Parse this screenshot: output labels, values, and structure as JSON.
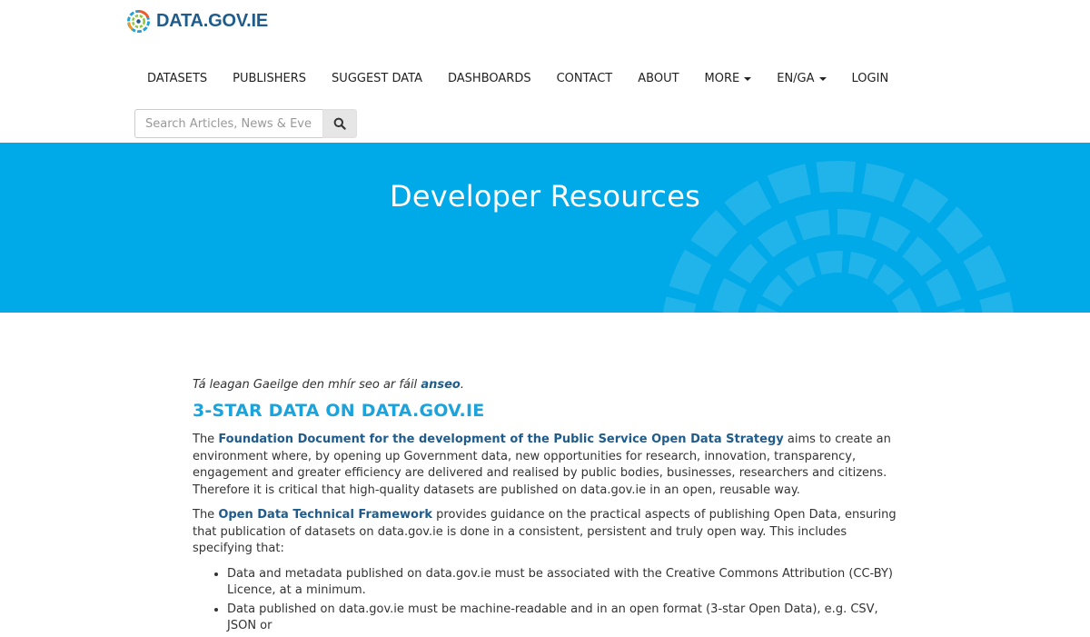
{
  "site": {
    "logo_text": "DATA.GOV.IE"
  },
  "nav": {
    "items": [
      "DATASETS",
      "PUBLISHERS",
      "SUGGEST DATA",
      "DASHBOARDS",
      "CONTACT",
      "ABOUT"
    ],
    "more_label": "MORE",
    "lang_label": "EN/GA",
    "login_label": "LOGIN"
  },
  "search": {
    "placeholder": "Search Articles, News & Events",
    "icon": "search-icon"
  },
  "hero": {
    "title": "Developer Resources",
    "color": "#00a9e8"
  },
  "content": {
    "irish_note": {
      "text": "Tá leagan Gaeilge den mhír seo ar fáil ",
      "link": "anseo",
      "suffix": "."
    },
    "section_title": "3-STAR DATA ON DATA.GOV.IE",
    "p1": {
      "pre": "The ",
      "link": "Foundation Document for the development of the Public Service Open Data Strategy",
      "post": " aims to create an environment where, by opening up Government data, new opportunities for research, innovation, transparency, engagement and greater efficiency are delivered and realised by public bodies, businesses, researchers and citizens. Therefore it is critical that high-quality datasets are published on data.gov.ie in an open, reusable way."
    },
    "p2": {
      "pre": "The ",
      "link": "Open Data Technical Framework",
      "post": " provides guidance on the practical aspects of publishing Open Data, ensuring that publication of datasets on data.gov.ie is done in a consistent, persistent and truly open way. This includes specifying that:"
    },
    "bullets": [
      "Data and metadata published on data.gov.ie must be associated with the Creative Commons Attribution (CC-BY) Licence, at a minimum.",
      "Data published on data.gov.ie must be machine-readable and in an open format (3-star Open Data), e.g. CSV, JSON or"
    ]
  },
  "colors": {
    "link": "#1f5c8b",
    "accent": "#1aa3dc",
    "logo": "#1f5c8b"
  }
}
